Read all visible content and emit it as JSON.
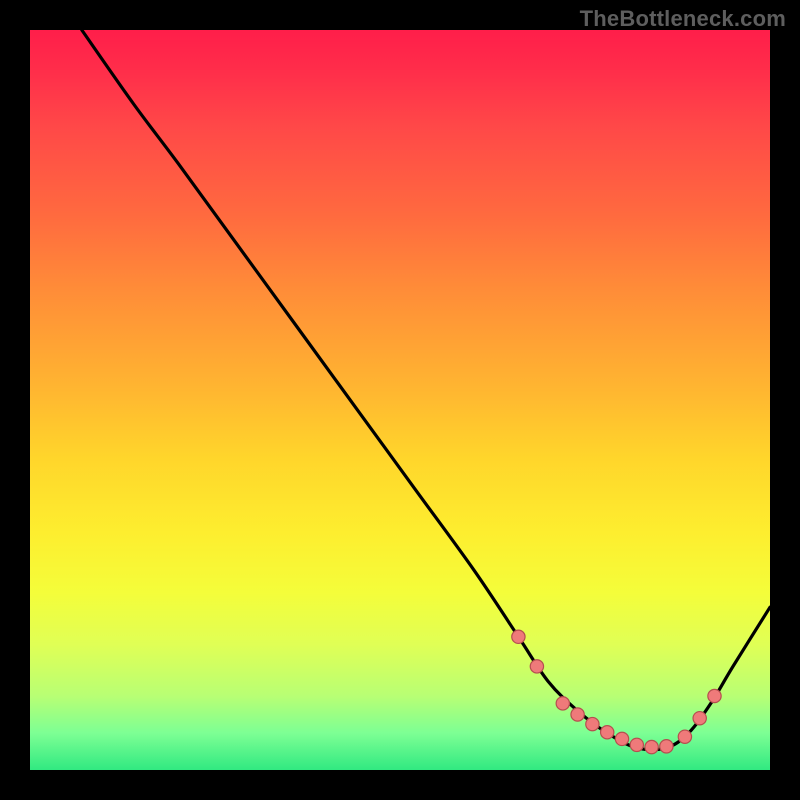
{
  "watermark": "TheBottleneck.com",
  "colors": {
    "dot_fill": "#ef7a7a",
    "dot_stroke": "#b54f4f",
    "curve_stroke": "#000000"
  },
  "chart_data": {
    "type": "line",
    "title": "",
    "xlabel": "",
    "ylabel": "",
    "xlim": [
      0,
      100
    ],
    "ylim": [
      0,
      100
    ],
    "grid": false,
    "series": [
      {
        "name": "curve",
        "x": [
          7,
          14,
          20,
          28,
          36,
          44,
          52,
          60,
          66,
          70,
          74,
          78,
          82,
          86,
          89,
          92,
          95,
          100
        ],
        "y": [
          100,
          90,
          82,
          71,
          60,
          49,
          38,
          27,
          18,
          12,
          8,
          5,
          3,
          3,
          5,
          9,
          14,
          22
        ]
      }
    ],
    "markers": {
      "name": "dots",
      "x": [
        66,
        68.5,
        72,
        74,
        76,
        78,
        80,
        82,
        84,
        86,
        88.5,
        90.5,
        92.5
      ],
      "y": [
        18,
        14,
        9,
        7.5,
        6.2,
        5.1,
        4.2,
        3.4,
        3.1,
        3.2,
        4.5,
        7,
        10
      ]
    }
  }
}
